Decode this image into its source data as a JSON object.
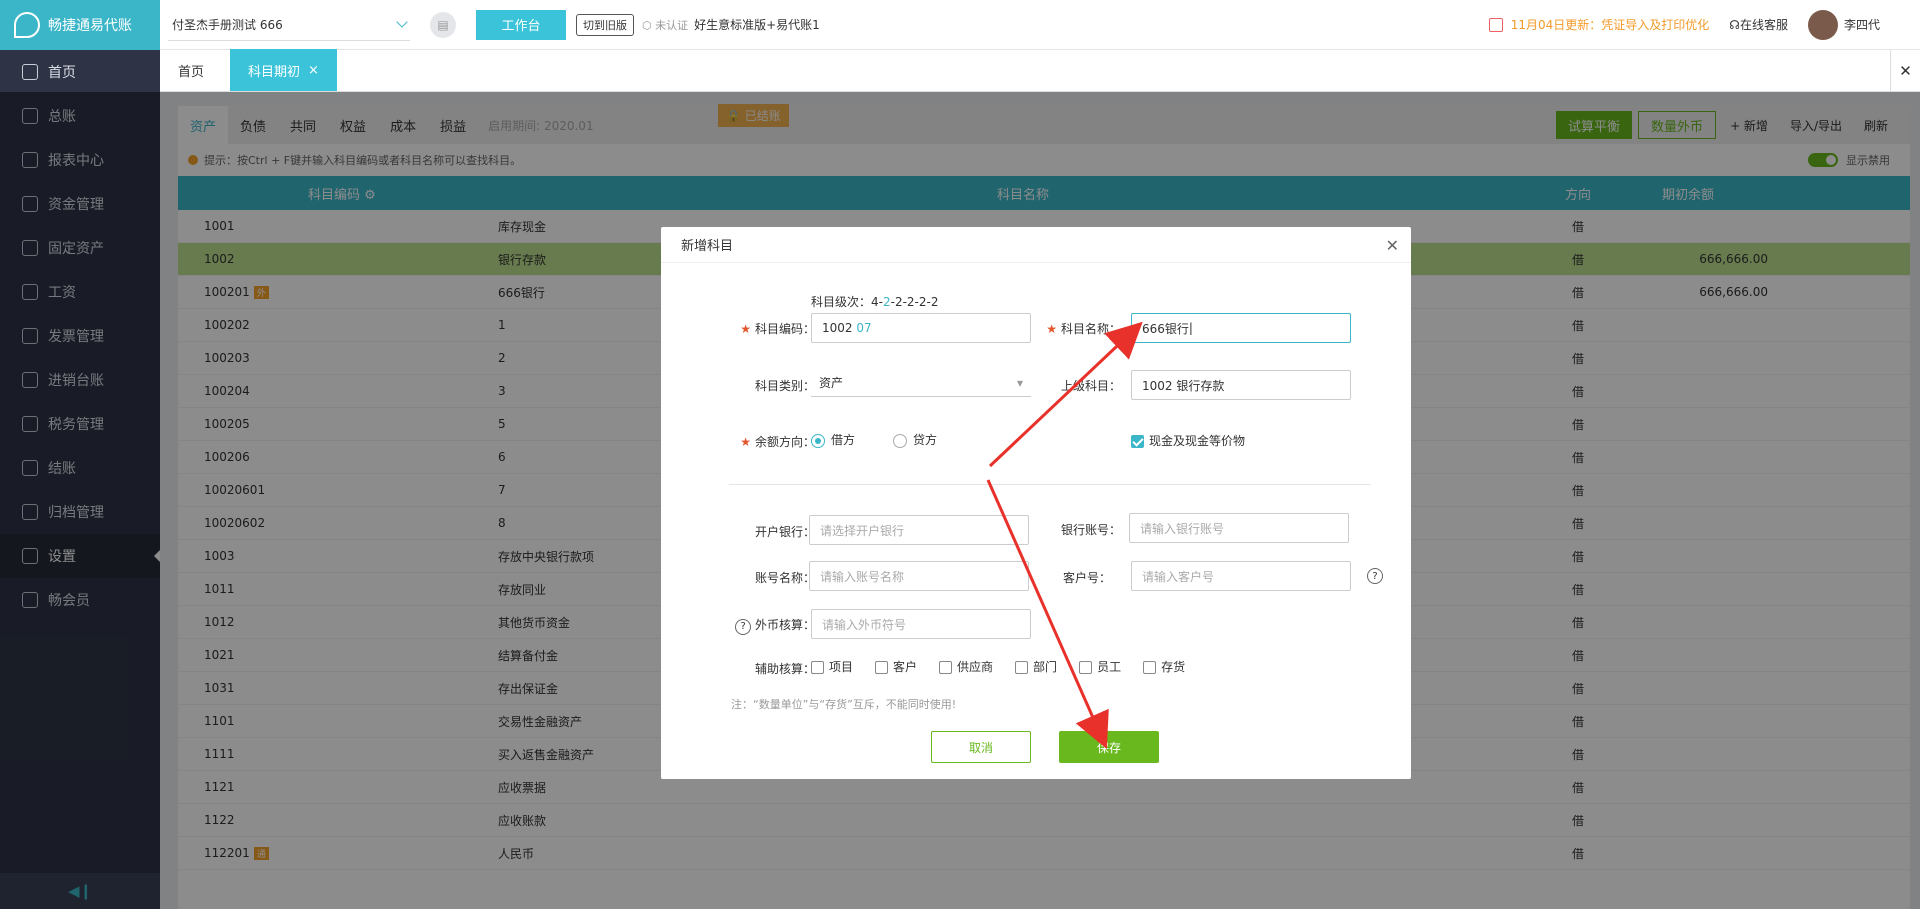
{
  "app": {
    "name": "畅捷通易代账"
  },
  "sidebar": {
    "items": [
      {
        "label": "首页",
        "icon": "home-icon"
      },
      {
        "label": "总账",
        "icon": "ledger-icon"
      },
      {
        "label": "报表中心",
        "icon": "chart-icon"
      },
      {
        "label": "资金管理",
        "icon": "money-icon"
      },
      {
        "label": "固定资产",
        "icon": "asset-icon"
      },
      {
        "label": "工资",
        "icon": "salary-icon"
      },
      {
        "label": "发票管理",
        "icon": "invoice-icon"
      },
      {
        "label": "进销台账",
        "icon": "inventory-icon"
      },
      {
        "label": "税务管理",
        "icon": "tax-icon"
      },
      {
        "label": "结账",
        "icon": "close-books-icon"
      },
      {
        "label": "归档管理",
        "icon": "archive-icon"
      },
      {
        "label": "设置",
        "icon": "gear-icon"
      },
      {
        "label": "畅会员",
        "icon": "vip-icon"
      }
    ],
    "active_index": 11
  },
  "topbar": {
    "company": "付圣杰手册测试 666",
    "workbench": "工作台",
    "switch_old": "切到旧版",
    "cert": "未认证",
    "plan": "好生意标准版+易代账1",
    "notice": "11月04日更新：凭证导入及打印优化",
    "service": "在线客服",
    "user": "李四代"
  },
  "tabs": [
    {
      "label": "首页"
    },
    {
      "label": "科目期初"
    }
  ],
  "subtabs": [
    {
      "label": "资产"
    },
    {
      "label": "负债"
    },
    {
      "label": "共同"
    },
    {
      "label": "权益"
    },
    {
      "label": "成本"
    },
    {
      "label": "损益"
    }
  ],
  "period": "启用期间: 2020.01",
  "locked": "已结账",
  "actions": {
    "trial": "试算平衡",
    "qty": "数量外币",
    "add": "+ 新增",
    "io": "导入/导出",
    "refresh": "刷新"
  },
  "hint": "提示：按Ctrl + F键并输入科目编码或者科目名称可以查找科目。",
  "show_disabled": "显示禁用",
  "table": {
    "headers": {
      "code": "科目编码",
      "name": "科目名称",
      "dir": "方向",
      "balance": "期初余额"
    },
    "rows": [
      {
        "code": "1001",
        "tag": "",
        "name": "库存现金",
        "dir": "借",
        "balance": ""
      },
      {
        "code": "1002",
        "tag": "",
        "name": "银行存款",
        "dir": "借",
        "balance": "666,666.00"
      },
      {
        "code": "100201",
        "tag": "外",
        "name": "666银行",
        "dir": "借",
        "balance": "666,666.00"
      },
      {
        "code": "100202",
        "tag": "",
        "name": "1",
        "dir": "借",
        "balance": ""
      },
      {
        "code": "100203",
        "tag": "",
        "name": "2",
        "dir": "借",
        "balance": ""
      },
      {
        "code": "100204",
        "tag": "",
        "name": "3",
        "dir": "借",
        "balance": ""
      },
      {
        "code": "100205",
        "tag": "",
        "name": "5",
        "dir": "借",
        "balance": ""
      },
      {
        "code": "100206",
        "tag": "",
        "name": "6",
        "dir": "借",
        "balance": ""
      },
      {
        "code": "10020601",
        "tag": "",
        "name": "7",
        "dir": "借",
        "balance": ""
      },
      {
        "code": "10020602",
        "tag": "",
        "name": "8",
        "dir": "借",
        "balance": ""
      },
      {
        "code": "1003",
        "tag": "",
        "name": "存放中央银行款项",
        "dir": "借",
        "balance": ""
      },
      {
        "code": "1011",
        "tag": "",
        "name": "存放同业",
        "dir": "借",
        "balance": ""
      },
      {
        "code": "1012",
        "tag": "",
        "name": "其他货币资金",
        "dir": "借",
        "balance": ""
      },
      {
        "code": "1021",
        "tag": "",
        "name": "结算备付金",
        "dir": "借",
        "balance": ""
      },
      {
        "code": "1031",
        "tag": "",
        "name": "存出保证金",
        "dir": "借",
        "balance": ""
      },
      {
        "code": "1101",
        "tag": "",
        "name": "交易性金融资产",
        "dir": "借",
        "balance": ""
      },
      {
        "code": "1111",
        "tag": "",
        "name": "买入返售金融资产",
        "dir": "借",
        "balance": ""
      },
      {
        "code": "1121",
        "tag": "",
        "name": "应收票据",
        "dir": "借",
        "balance": ""
      },
      {
        "code": "1122",
        "tag": "",
        "name": "应收账款",
        "dir": "借",
        "balance": ""
      },
      {
        "code": "112201",
        "tag": "通",
        "name": "人民币",
        "dir": "借",
        "balance": ""
      }
    ]
  },
  "dialog": {
    "title": "新增科目",
    "level_label": "科目级次：",
    "level_first": "4-",
    "level_highlight": "2",
    "level_rest": "-2-2-2-2",
    "code_label": "科目编码：",
    "code_prefix": "1002",
    "code_suffix": "07",
    "name_label": "科目名称：",
    "name_value": "666银行",
    "type_label": "科目类别：",
    "type_value": "资产",
    "parent_label": "上级科目：",
    "parent_value": "1002 银行存款",
    "dir_label": "余额方向：",
    "debit": "借方",
    "credit": "贷方",
    "cash_equiv": "现金及现金等价物",
    "bank_label": "开户银行：",
    "bank_ph": "请选择开户银行",
    "acct_no_label": "银行账号：",
    "acct_no_ph": "请输入银行账号",
    "acct_name_label": "账号名称：",
    "acct_name_ph": "请输入账号名称",
    "cust_no_label": "客户号：",
    "cust_no_ph": "请输入客户号",
    "fx_label": "外币核算：",
    "fx_ph": "请输入外币符号",
    "aux_label": "辅助核算：",
    "aux": [
      "项目",
      "客户",
      "供应商",
      "部门",
      "员工",
      "存货"
    ],
    "note": "注：“数量单位”与“存货”互斥，不能同时使用!",
    "cancel": "取消",
    "save": "保存"
  }
}
